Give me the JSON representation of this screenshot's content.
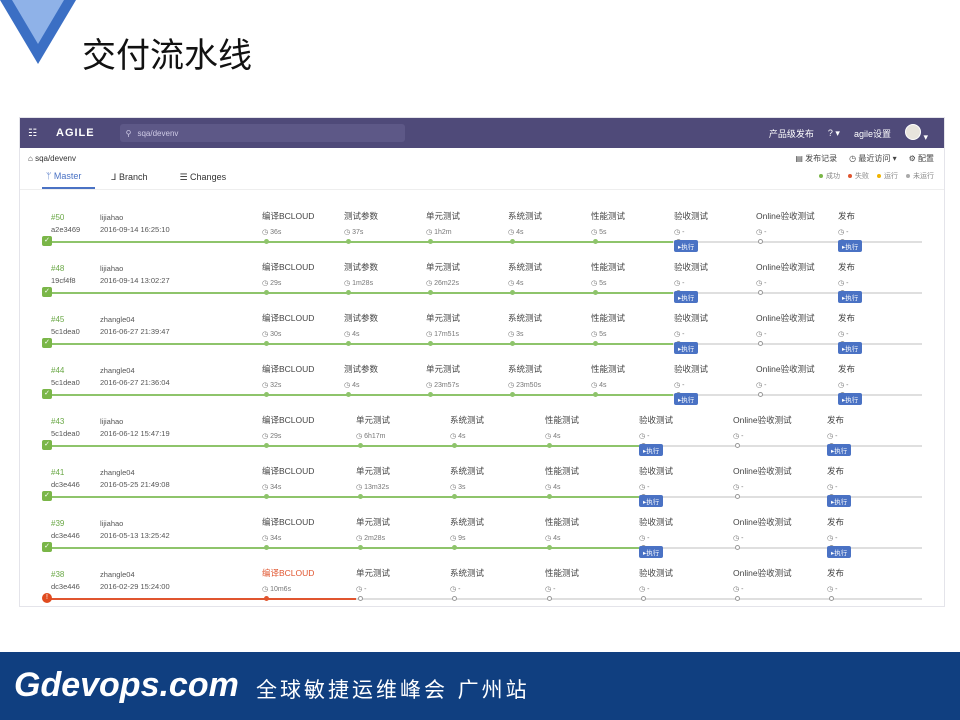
{
  "slide": {
    "title": "交付流水线"
  },
  "app": {
    "brand": "AGILE",
    "search": "sqa/devenv",
    "nav": [
      "产品级发布",
      "?",
      "agile设置"
    ]
  },
  "breadcrumb": "sqa/devenv",
  "actions": [
    "发布记录",
    "最近访问",
    "配置"
  ],
  "tabs": [
    "Master",
    "Branch",
    "Changes"
  ],
  "legend": [
    {
      "label": "成功",
      "color": "#7ab648"
    },
    {
      "label": "失败",
      "color": "#e0552f"
    },
    {
      "label": "运行",
      "color": "#f0b400"
    },
    {
      "label": "未运行",
      "color": "#aaaaaa"
    }
  ],
  "run_label": "执行",
  "rows": [
    {
      "num": "#50",
      "hash": "a2e3469",
      "user": "lijiahao",
      "date": "2016-09-14 16:25:10",
      "status": "ok",
      "stages": [
        {
          "name": "编译BCLOUD",
          "time": "36s",
          "state": "ok"
        },
        {
          "name": "测试参数",
          "time": "37s",
          "state": "ok"
        },
        {
          "name": "单元测试",
          "time": "1h2m",
          "state": "ok"
        },
        {
          "name": "系统测试",
          "time": "4s",
          "state": "ok"
        },
        {
          "name": "性能测试",
          "time": "5s",
          "state": "ok"
        },
        {
          "name": "验收测试",
          "time": "-",
          "state": "todo",
          "btn": true
        },
        {
          "name": "Online验收测试",
          "time": "-",
          "state": "todo"
        },
        {
          "name": "发布",
          "time": "-",
          "state": "todo",
          "btn": true
        }
      ]
    },
    {
      "num": "#48",
      "hash": "19cf4f8",
      "user": "lijiahao",
      "date": "2016-09-14 13:02:27",
      "status": "ok",
      "stages": [
        {
          "name": "编译BCLOUD",
          "time": "29s",
          "state": "ok"
        },
        {
          "name": "测试参数",
          "time": "1m28s",
          "state": "ok"
        },
        {
          "name": "单元测试",
          "time": "26m22s",
          "state": "ok"
        },
        {
          "name": "系统测试",
          "time": "4s",
          "state": "ok"
        },
        {
          "name": "性能测试",
          "time": "5s",
          "state": "ok"
        },
        {
          "name": "验收测试",
          "time": "-",
          "state": "todo",
          "btn": true
        },
        {
          "name": "Online验收测试",
          "time": "-",
          "state": "todo"
        },
        {
          "name": "发布",
          "time": "-",
          "state": "todo",
          "btn": true
        }
      ]
    },
    {
      "num": "#45",
      "hash": "5c1dea0",
      "user": "zhangle04",
      "date": "2016-06-27 21:39:47",
      "status": "ok",
      "stages": [
        {
          "name": "编译BCLOUD",
          "time": "30s",
          "state": "ok"
        },
        {
          "name": "测试参数",
          "time": "4s",
          "state": "ok"
        },
        {
          "name": "单元测试",
          "time": "17m51s",
          "state": "ok"
        },
        {
          "name": "系统测试",
          "time": "3s",
          "state": "ok"
        },
        {
          "name": "性能测试",
          "time": "5s",
          "state": "ok"
        },
        {
          "name": "验收测试",
          "time": "-",
          "state": "todo",
          "btn": true
        },
        {
          "name": "Online验收测试",
          "time": "-",
          "state": "todo"
        },
        {
          "name": "发布",
          "time": "-",
          "state": "todo",
          "btn": true
        }
      ]
    },
    {
      "num": "#44",
      "hash": "5c1dea0",
      "user": "zhangle04",
      "date": "2016-06-27 21:36:04",
      "status": "ok",
      "stages": [
        {
          "name": "编译BCLOUD",
          "time": "32s",
          "state": "ok"
        },
        {
          "name": "测试参数",
          "time": "4s",
          "state": "ok"
        },
        {
          "name": "单元测试",
          "time": "23m57s",
          "state": "ok"
        },
        {
          "name": "系统测试",
          "time": "23m50s",
          "state": "ok"
        },
        {
          "name": "性能测试",
          "time": "4s",
          "state": "ok"
        },
        {
          "name": "验收测试",
          "time": "-",
          "state": "todo",
          "btn": true
        },
        {
          "name": "Online验收测试",
          "time": "-",
          "state": "todo"
        },
        {
          "name": "发布",
          "time": "-",
          "state": "todo",
          "btn": true
        }
      ]
    },
    {
      "num": "#43",
      "hash": "5c1dea0",
      "user": "lijiahao",
      "date": "2016-06-12 15:47:19",
      "status": "ok",
      "stages": [
        {
          "name": "编译BCLOUD",
          "time": "29s",
          "state": "ok"
        },
        {
          "name": "单元测试",
          "time": "6h17m",
          "state": "ok"
        },
        {
          "name": "系统测试",
          "time": "4s",
          "state": "ok"
        },
        {
          "name": "性能测试",
          "time": "4s",
          "state": "ok"
        },
        {
          "name": "验收测试",
          "time": "-",
          "state": "todo",
          "btn": true
        },
        {
          "name": "Online验收测试",
          "time": "-",
          "state": "todo"
        },
        {
          "name": "发布",
          "time": "-",
          "state": "todo",
          "btn": true
        }
      ]
    },
    {
      "num": "#41",
      "hash": "dc3e446",
      "user": "zhangle04",
      "date": "2016-05-25 21:49:08",
      "status": "ok",
      "stages": [
        {
          "name": "编译BCLOUD",
          "time": "34s",
          "state": "ok"
        },
        {
          "name": "单元测试",
          "time": "13m32s",
          "state": "ok"
        },
        {
          "name": "系统测试",
          "time": "3s",
          "state": "ok"
        },
        {
          "name": "性能测试",
          "time": "4s",
          "state": "ok"
        },
        {
          "name": "验收测试",
          "time": "-",
          "state": "todo",
          "btn": true
        },
        {
          "name": "Online验收测试",
          "time": "-",
          "state": "todo"
        },
        {
          "name": "发布",
          "time": "-",
          "state": "todo",
          "btn": true
        }
      ]
    },
    {
      "num": "#39",
      "hash": "dc3e446",
      "user": "lijiahao",
      "date": "2016-05-13 13:25:42",
      "status": "ok",
      "stages": [
        {
          "name": "编译BCLOUD",
          "time": "34s",
          "state": "ok"
        },
        {
          "name": "单元测试",
          "time": "2m28s",
          "state": "ok"
        },
        {
          "name": "系统测试",
          "time": "9s",
          "state": "ok"
        },
        {
          "name": "性能测试",
          "time": "4s",
          "state": "ok"
        },
        {
          "name": "验收测试",
          "time": "-",
          "state": "todo",
          "btn": true
        },
        {
          "name": "Online验收测试",
          "time": "-",
          "state": "todo"
        },
        {
          "name": "发布",
          "time": "-",
          "state": "todo",
          "btn": true
        }
      ]
    },
    {
      "num": "#38",
      "hash": "dc3e446",
      "user": "zhangle04",
      "date": "2016-02-29 15:24:00",
      "status": "fail",
      "stages": [
        {
          "name": "编译BCLOUD",
          "time": "10m6s",
          "state": "fail"
        },
        {
          "name": "单元测试",
          "time": "-",
          "state": "todo"
        },
        {
          "name": "系统测试",
          "time": "-",
          "state": "todo"
        },
        {
          "name": "性能测试",
          "time": "-",
          "state": "todo"
        },
        {
          "name": "验收测试",
          "time": "-",
          "state": "todo"
        },
        {
          "name": "Online验收测试",
          "time": "-",
          "state": "todo"
        },
        {
          "name": "发布",
          "time": "-",
          "state": "todo"
        }
      ]
    }
  ],
  "footer": {
    "brand": "Gdevops.com",
    "tagline": "全球敏捷运维峰会 广州站"
  }
}
